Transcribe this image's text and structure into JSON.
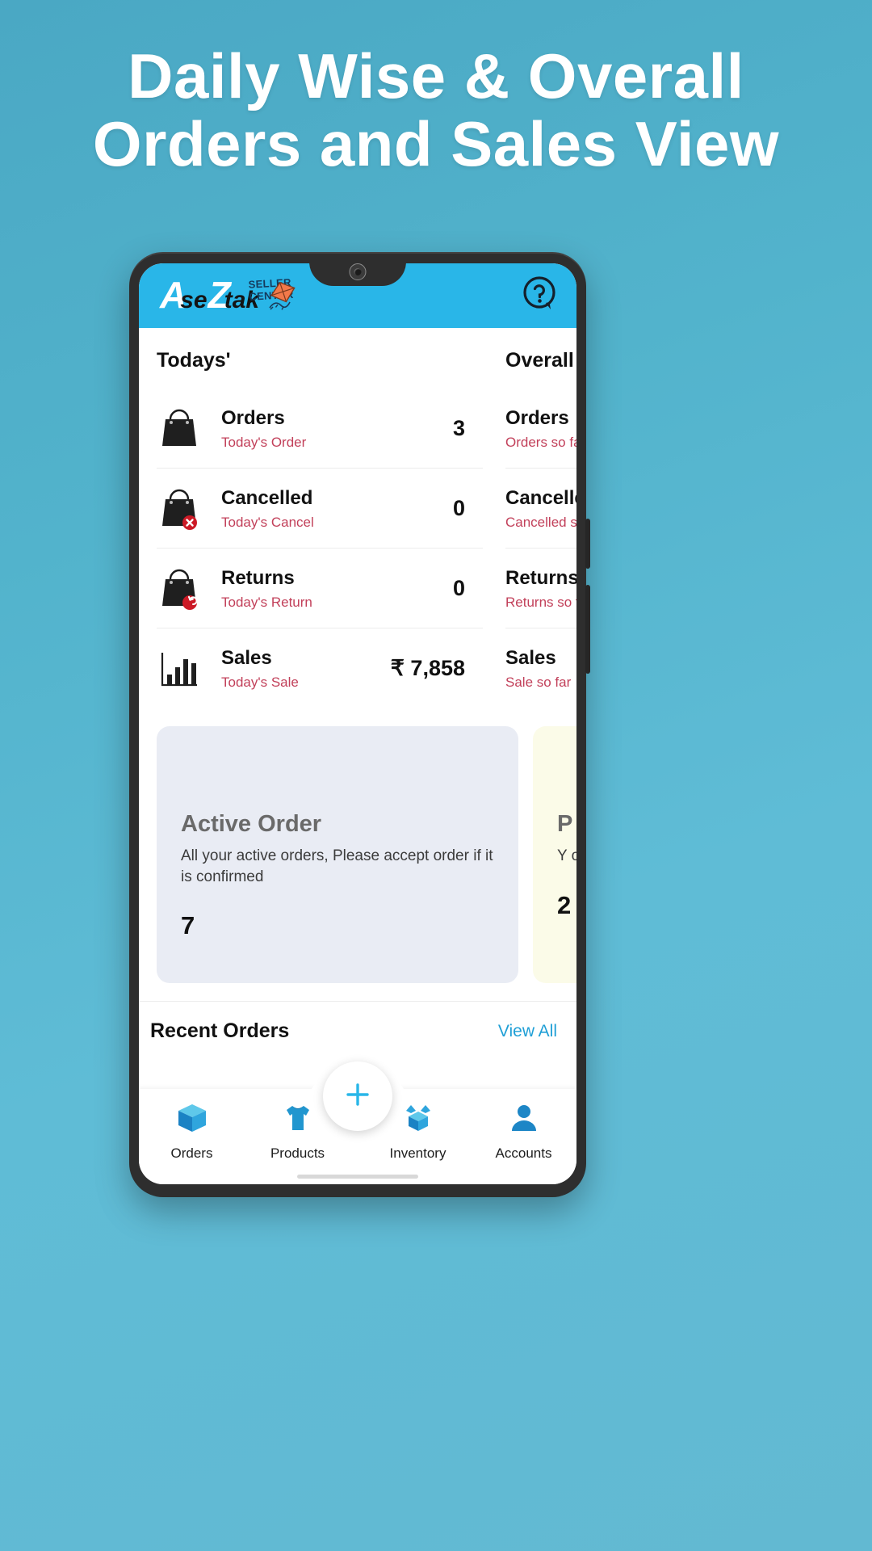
{
  "banner": {
    "line1": "Daily Wise & Overall",
    "line2": "Orders and Sales View",
    "bg_color": "#52b3cc",
    "text_color": "#ffffff"
  },
  "app": {
    "header": {
      "brand_mark": "A",
      "brand_se": "se",
      "brand_z": "Z",
      "brand_tak": "tak",
      "tagline": "SELLER CENTER",
      "accent_color": "#29b6e8",
      "help_icon": "help-circle-icon",
      "kite_icon": "kite-icon"
    },
    "stats": {
      "today": {
        "title": "Todays'",
        "rows": [
          {
            "icon": "shopping-bag-icon",
            "name": "Orders",
            "sub": "Today's Order",
            "value": "3"
          },
          {
            "icon": "shopping-bag-cancel-icon",
            "name": "Cancelled",
            "sub": "Today's Cancel",
            "value": "0"
          },
          {
            "icon": "shopping-bag-return-icon",
            "name": "Returns",
            "sub": "Today's Return",
            "value": "0"
          },
          {
            "icon": "bar-chart-icon",
            "name": "Sales",
            "sub": "Today's Sale",
            "value": "₹ 7,858"
          }
        ]
      },
      "overall": {
        "title": "Overall",
        "rows": [
          {
            "name": "Orders",
            "sub": "Orders so far"
          },
          {
            "name": "Cancelled",
            "sub": "Cancelled so far"
          },
          {
            "name": "Returns",
            "sub": "Returns so far"
          },
          {
            "name": "Sales",
            "sub": "Sale so far"
          }
        ]
      }
    },
    "cards": [
      {
        "title": "Active Order",
        "desc": "All your active orders, Please accept order if it is confirmed",
        "count": "7",
        "bg": "#e9ecf4"
      },
      {
        "title": "P",
        "desc": "Y o",
        "count": "2",
        "bg": "#fbfbe8"
      }
    ],
    "recent": {
      "title": "Recent Orders",
      "view_all": "View All",
      "link_color": "#1f9fd6"
    },
    "bottom_nav": {
      "fab_icon": "plus-icon",
      "items": [
        {
          "icon": "box-icon",
          "label": "Orders"
        },
        {
          "icon": "tshirt-icon",
          "label": "Products"
        },
        {
          "icon": "inventory-icon",
          "label": "Inventory"
        },
        {
          "icon": "person-icon",
          "label": "Accounts"
        }
      ]
    }
  }
}
